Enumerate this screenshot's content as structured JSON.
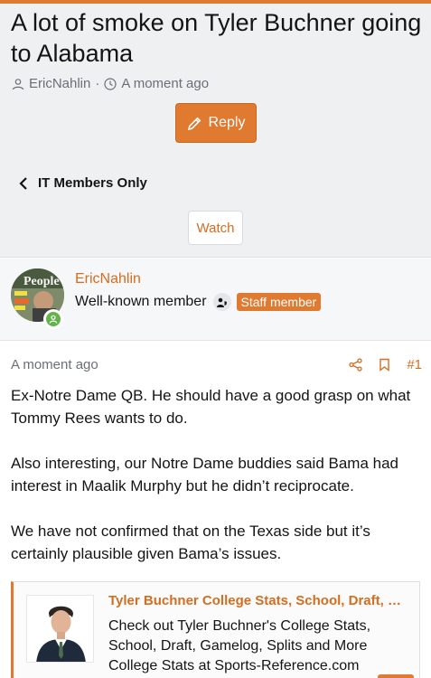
{
  "thread": {
    "title": "A lot of smoke on Tyler Buchner going to Alabama",
    "author": "EricNahlin",
    "separator": "·",
    "time": "A moment ago"
  },
  "actions": {
    "reply_label": "Reply",
    "watch_label": "Watch"
  },
  "breadcrumb": {
    "label": "IT Members Only"
  },
  "user": {
    "name": "EricNahlin",
    "title": "Well-known member",
    "badge": "Staff member",
    "avatar_text": "People"
  },
  "post": {
    "time": "A moment ago",
    "number": "#1",
    "paragraphs": [
      "Ex-Notre Dame QB. He should have a good grasp on what Tommy Rees wants to do.",
      "Also interesting, our Notre Dame buddies said Bama had interest in Maalik Murphy but he didn’t reciprocate.",
      "We have not confirmed that on the Texas side but it’s certainly plausible given Bama’s issues."
    ]
  },
  "embed": {
    "title": "Tyler Buchner College Stats, School, Draft, Gamelog, Splits and More College Stats at Sports-Reference.com",
    "description": "Check out Tyler Buchner's College Stats, School, Draft, Gamelog, Splits and More College Stats at Sports-Reference.com"
  },
  "colors": {
    "accent": "#e07a31",
    "header_bg": "#eff0f2",
    "online": "#63b24a"
  },
  "icons": {
    "author": "user-icon",
    "time": "clock-icon",
    "reply": "pencil-icon",
    "back": "chevron-left-icon",
    "share": "share-icon",
    "bookmark": "bookmark-icon",
    "staff": "user-shield-icon"
  }
}
